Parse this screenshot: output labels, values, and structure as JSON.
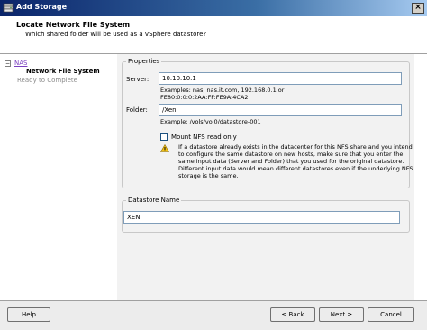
{
  "window": {
    "title": "Add Storage",
    "close_glyph": "×"
  },
  "header": {
    "title": "Locate Network File System",
    "subtitle": "Which shared folder will be used as a vSphere datastore?"
  },
  "nav": {
    "root_label": "NAS",
    "items": [
      {
        "label": "Network File System",
        "state": "current"
      },
      {
        "label": "Ready to Complete",
        "state": "pending"
      }
    ]
  },
  "properties": {
    "group_label": "Properties",
    "server": {
      "label": "Server:",
      "value": "10.10.10.1",
      "examples_line1": "Examples: nas, nas.it.com, 192.168.0.1 or",
      "examples_line2": "FE80:0:0:0:2AA:FF:FE9A:4CA2"
    },
    "folder": {
      "label": "Folder:",
      "value": "/Xen",
      "example": "Example: /vols/vol0/datastore-001"
    },
    "mount_read_only": {
      "label": "Mount NFS read only",
      "checked": false
    },
    "warning_lines": [
      "If a datastore already exists in the datacenter for this NFS share and you intend",
      "to configure the same datastore on new hosts, make sure that you enter the",
      "same input data (Server and Folder) that you used for the original datastore.",
      "Different input data would mean different datastores even if the underlying NFS",
      "storage is the same."
    ]
  },
  "datastore": {
    "group_label": "Datastore Name",
    "value": "XEN"
  },
  "buttons": {
    "help": "Help",
    "back": "≤ Back",
    "next": "Next ≥",
    "cancel": "Cancel"
  },
  "icons": {
    "title_icon": "storage-icon",
    "warning_icon": "warning-icon"
  },
  "colors": {
    "title_bar_start": "#0a246a",
    "title_bar_end": "#a6caf0",
    "link": "#7a3fc0",
    "current_step": "#000000",
    "pending_step": "#8a8a8a",
    "warning_fill": "#f5c518"
  }
}
